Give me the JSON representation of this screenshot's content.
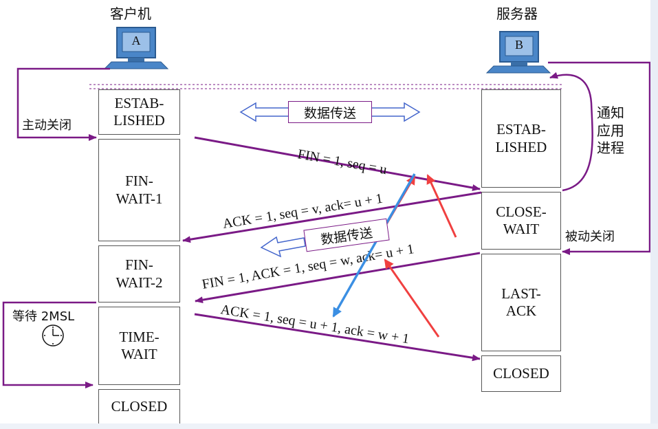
{
  "client": {
    "title": "客户机",
    "label": "A"
  },
  "server": {
    "title": "服务器",
    "label": "B"
  },
  "left_actions": {
    "active_close": "主动关闭",
    "wait_2msl": "等待 2MSL"
  },
  "right_actions": {
    "notify_app": [
      "通知",
      "应用",
      "进程"
    ],
    "passive_close": "被动关闭"
  },
  "client_states": [
    {
      "name": "ESTAB-\nLISHED"
    },
    {
      "name": "FIN-\nWAIT-1"
    },
    {
      "name": "FIN-\nWAIT-2"
    },
    {
      "name": "TIME-\nWAIT"
    },
    {
      "name": "CLOSED"
    }
  ],
  "server_states": [
    {
      "name": "ESTAB-\nLISHED"
    },
    {
      "name": "CLOSE-\nWAIT"
    },
    {
      "name": "LAST-\nACK"
    },
    {
      "name": "CLOSED"
    }
  ],
  "data_transfer": [
    "数据传送",
    "数据传送"
  ],
  "messages": [
    "FIN = 1, seq = u",
    "ACK = 1, seq = v, ack= u + 1",
    "FIN = 1, ACK = 1, seq = w, ack= u + 1",
    "ACK = 1, seq = u + 1, ack = w + 1"
  ],
  "colors": {
    "arrow": "#7a1a86",
    "red": "#f04040",
    "blue": "#3b8fe3",
    "box_border": "#555555"
  }
}
